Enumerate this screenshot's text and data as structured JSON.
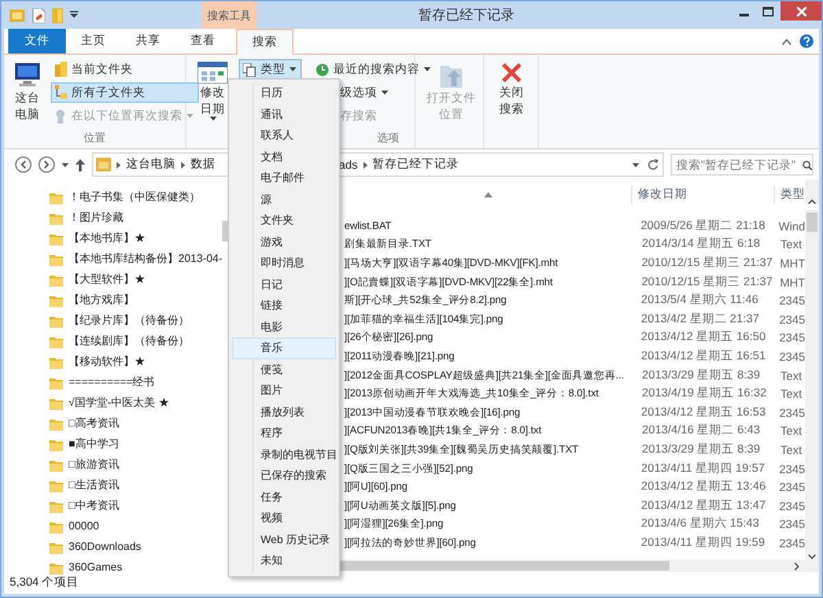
{
  "window": {
    "title": "暂存已经下记录",
    "contextual_tab_group": "搜索工具"
  },
  "tabs": [
    {
      "label": "文件",
      "kind": "file",
      "selected": false
    },
    {
      "label": "主页",
      "kind": "tab",
      "selected": false
    },
    {
      "label": "共享",
      "kind": "tab",
      "selected": false
    },
    {
      "label": "查看",
      "kind": "tab",
      "selected": false
    },
    {
      "label": "搜索",
      "kind": "tab",
      "selected": true
    }
  ],
  "ribbon": {
    "location_group": {
      "label": "位置",
      "large_button": "这台电脑",
      "items": [
        {
          "label": "当前文件夹",
          "selected": false,
          "disabled": false,
          "dropdown": false
        },
        {
          "label": "所有子文件夹",
          "selected": true,
          "disabled": false,
          "dropdown": false
        },
        {
          "label": "在以下位置再次搜索",
          "selected": false,
          "disabled": true,
          "dropdown": true
        }
      ]
    },
    "refine_group": {
      "date_button": "修改日期",
      "type_button": {
        "label": "类型",
        "pressed": true
      }
    },
    "options_group": {
      "label": "选项",
      "items": [
        {
          "label": "最近的搜索内容",
          "disabled": false,
          "dropdown": true
        },
        {
          "label": "级选项",
          "disabled": false,
          "dropdown": true
        },
        {
          "label": "存搜索",
          "disabled": true,
          "dropdown": false
        }
      ]
    },
    "open_location": {
      "label": "打开文件位置",
      "disabled": true
    },
    "close_search": {
      "label": "关闭搜索",
      "disabled": false
    }
  },
  "address_bar": {
    "segments_before": [
      "这台电脑",
      "数据"
    ],
    "segments_after": [
      "ads",
      "暂存已经下记录"
    ],
    "search_placeholder": "搜索\"暂存已经下记录\""
  },
  "navigation_pane": {
    "items": [
      "！电子书集（中医保健类）",
      "！图片珍藏",
      "【本地书库】★",
      "【本地书库结构备份】2013-04-",
      "【大型软件】★",
      "【地方戏库】",
      "【纪录片库】（待备份）",
      "【连续剧库】（待备份）",
      "【移动软件】★",
      "==========经书",
      "√国学堂-中医太美 ★",
      "□高考资讯",
      "■高中学习",
      "□旅游资讯",
      "□生活资讯",
      "□中考资讯",
      "00000",
      "360Downloads",
      "360Games"
    ]
  },
  "file_list": {
    "columns": [
      "修改日期",
      "类型"
    ],
    "rows": [
      {
        "name": "ewlist.BAT",
        "date": "2009/5/26 星期二 21:18",
        "type": "Wind"
      },
      {
        "name": "剧集最新目录.TXT",
        "date": "2014/3/14 星期五 6:18",
        "type": "Text"
      },
      {
        "name": "][马场大亨][双语字幕40集][DVD-MKV][FK].mht",
        "date": "2010/12/15 星期三 21:37",
        "type": "MHT"
      },
      {
        "name": "][O記賣蝶][双语字幕][DVD-MKV][22集全].mht",
        "date": "2010/12/15 星期三 21:37",
        "type": "MHT"
      },
      {
        "name": "斯][开心球_共52集全_评分8.2].png",
        "date": "2013/5/4 星期六 11:46",
        "type": "2345"
      },
      {
        "name": "][加菲猫的幸福生活][104集完].png",
        "date": "2013/4/2 星期二 21:37",
        "type": "2345"
      },
      {
        "name": "][26个秘密][26].png",
        "date": "2013/4/12 星期五 16:50",
        "type": "2345"
      },
      {
        "name": "][2011动漫春晚][21].png",
        "date": "2013/4/12 星期五 16:51",
        "type": "2345"
      },
      {
        "name": "][2012金面具COSPLAY超级盛典][共21集全][金面具邀您再...",
        "date": "2013/3/29 星期五 8:39",
        "type": "Text"
      },
      {
        "name": "][2013原创动画开年大戏海选_共10集全_评分：8.0].txt",
        "date": "2013/4/19 星期五 16:32",
        "type": "Text"
      },
      {
        "name": "][2013中国动漫春节联欢晚会][16].png",
        "date": "2013/4/12 星期五 16:53",
        "type": "2345"
      },
      {
        "name": "][ACFUN2013春晚][共1集全_评分：8.0].txt",
        "date": "2013/4/16 星期二 6:43",
        "type": "Text"
      },
      {
        "name": "][Q版刘关张][共39集全][魏蜀吴历史搞笑颠覆].TXT",
        "date": "2013/3/29 星期五 8:39",
        "type": "Text"
      },
      {
        "name": "][Q版三国之三小强][52].png",
        "date": "2013/4/11 星期四 19:57",
        "type": "2345"
      },
      {
        "name": "][阿U][60].png",
        "date": "2013/4/12 星期五 13:46",
        "type": "2345"
      },
      {
        "name": "][阿U动画英文版][5].png",
        "date": "2013/4/12 星期五 13:47",
        "type": "2345"
      },
      {
        "name": "][阿湿狸][26集全].png",
        "date": "2013/4/6 星期六 15:43",
        "type": "2345"
      },
      {
        "name": "][阿拉法的奇妙世界][60].png",
        "date": "2013/4/11 星期四 19:59",
        "type": "2345"
      }
    ]
  },
  "type_menu": {
    "items": [
      {
        "label": "日历",
        "selected": false
      },
      {
        "label": "通讯",
        "selected": false
      },
      {
        "label": "联系人",
        "selected": false
      },
      {
        "label": "文档",
        "selected": false
      },
      {
        "label": "电子邮件",
        "selected": false
      },
      {
        "label": "源",
        "selected": false
      },
      {
        "label": "文件夹",
        "selected": false
      },
      {
        "label": "游戏",
        "selected": false
      },
      {
        "label": "即时消息",
        "selected": false
      },
      {
        "label": "日记",
        "selected": false
      },
      {
        "label": "链接",
        "selected": false
      },
      {
        "label": "电影",
        "selected": false
      },
      {
        "label": "音乐",
        "selected": true
      },
      {
        "label": "便笺",
        "selected": false
      },
      {
        "label": "图片",
        "selected": false
      },
      {
        "label": "播放列表",
        "selected": false
      },
      {
        "label": "程序",
        "selected": false
      },
      {
        "label": "录制的电视节目",
        "selected": false
      },
      {
        "label": "已保存的搜索",
        "selected": false
      },
      {
        "label": "任务",
        "selected": false
      },
      {
        "label": "视频",
        "selected": false
      },
      {
        "label": "Web 历史记录",
        "selected": false
      },
      {
        "label": "未知",
        "selected": false
      }
    ]
  },
  "status_bar": {
    "item_count": "5,304 个项目"
  }
}
